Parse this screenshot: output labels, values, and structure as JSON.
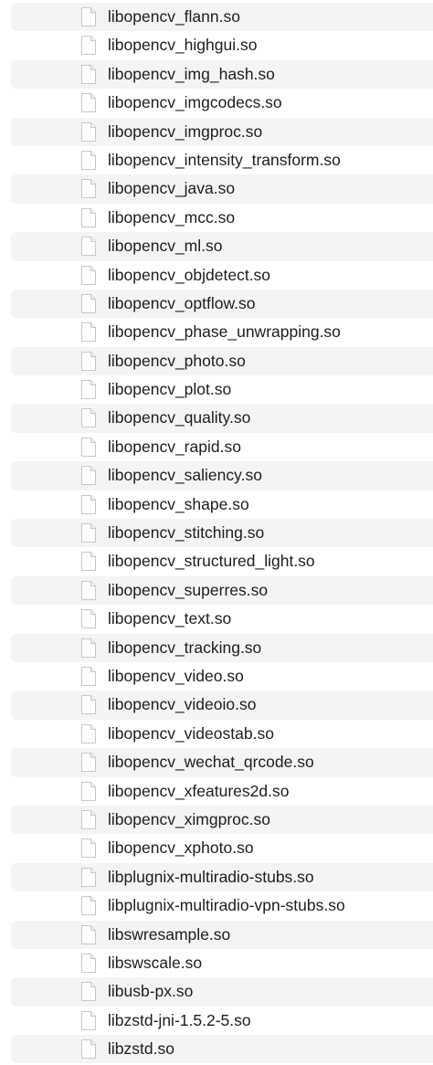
{
  "files": [
    {
      "name": "libopencv_flann.so"
    },
    {
      "name": "libopencv_highgui.so"
    },
    {
      "name": "libopencv_img_hash.so"
    },
    {
      "name": "libopencv_imgcodecs.so"
    },
    {
      "name": "libopencv_imgproc.so"
    },
    {
      "name": "libopencv_intensity_transform.so"
    },
    {
      "name": "libopencv_java.so"
    },
    {
      "name": "libopencv_mcc.so"
    },
    {
      "name": "libopencv_ml.so"
    },
    {
      "name": "libopencv_objdetect.so"
    },
    {
      "name": "libopencv_optflow.so"
    },
    {
      "name": "libopencv_phase_unwrapping.so"
    },
    {
      "name": "libopencv_photo.so"
    },
    {
      "name": "libopencv_plot.so"
    },
    {
      "name": "libopencv_quality.so"
    },
    {
      "name": "libopencv_rapid.so"
    },
    {
      "name": "libopencv_saliency.so"
    },
    {
      "name": "libopencv_shape.so"
    },
    {
      "name": "libopencv_stitching.so"
    },
    {
      "name": "libopencv_structured_light.so"
    },
    {
      "name": "libopencv_superres.so"
    },
    {
      "name": "libopencv_text.so"
    },
    {
      "name": "libopencv_tracking.so"
    },
    {
      "name": "libopencv_video.so"
    },
    {
      "name": "libopencv_videoio.so"
    },
    {
      "name": "libopencv_videostab.so"
    },
    {
      "name": "libopencv_wechat_qrcode.so"
    },
    {
      "name": "libopencv_xfeatures2d.so"
    },
    {
      "name": "libopencv_ximgproc.so"
    },
    {
      "name": "libopencv_xphoto.so"
    },
    {
      "name": "libplugnix-multiradio-stubs.so"
    },
    {
      "name": "libplugnix-multiradio-vpn-stubs.so"
    },
    {
      "name": "libswresample.so"
    },
    {
      "name": "libswscale.so"
    },
    {
      "name": "libusb-px.so"
    },
    {
      "name": "libzstd-jni-1.5.2-5.so"
    },
    {
      "name": "libzstd.so"
    }
  ],
  "icon": "generic-document-icon",
  "colors": {
    "stripe": "#f4f4f5",
    "text": "#1d1d1f",
    "icon_outline": "#c7c7cc"
  }
}
